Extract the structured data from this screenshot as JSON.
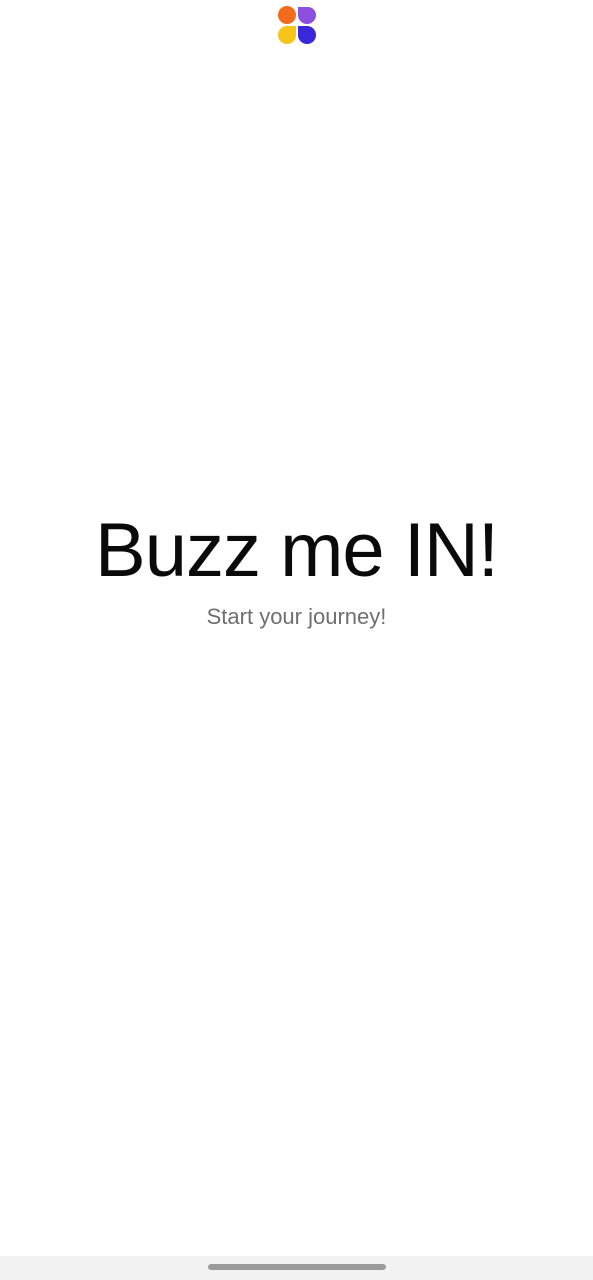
{
  "app": {
    "logo_icon": "four-petal-app-logo-icon",
    "logo_colors": {
      "top_left": "#F26A1B",
      "top_right": "#8C4FE0",
      "bottom_left": "#F7C41A",
      "bottom_right": "#3A27D9"
    }
  },
  "splash": {
    "title": "Buzz me IN!",
    "subtitle": "Start your journey!"
  },
  "system": {
    "home_indicator_icon": "home-indicator-bar"
  }
}
